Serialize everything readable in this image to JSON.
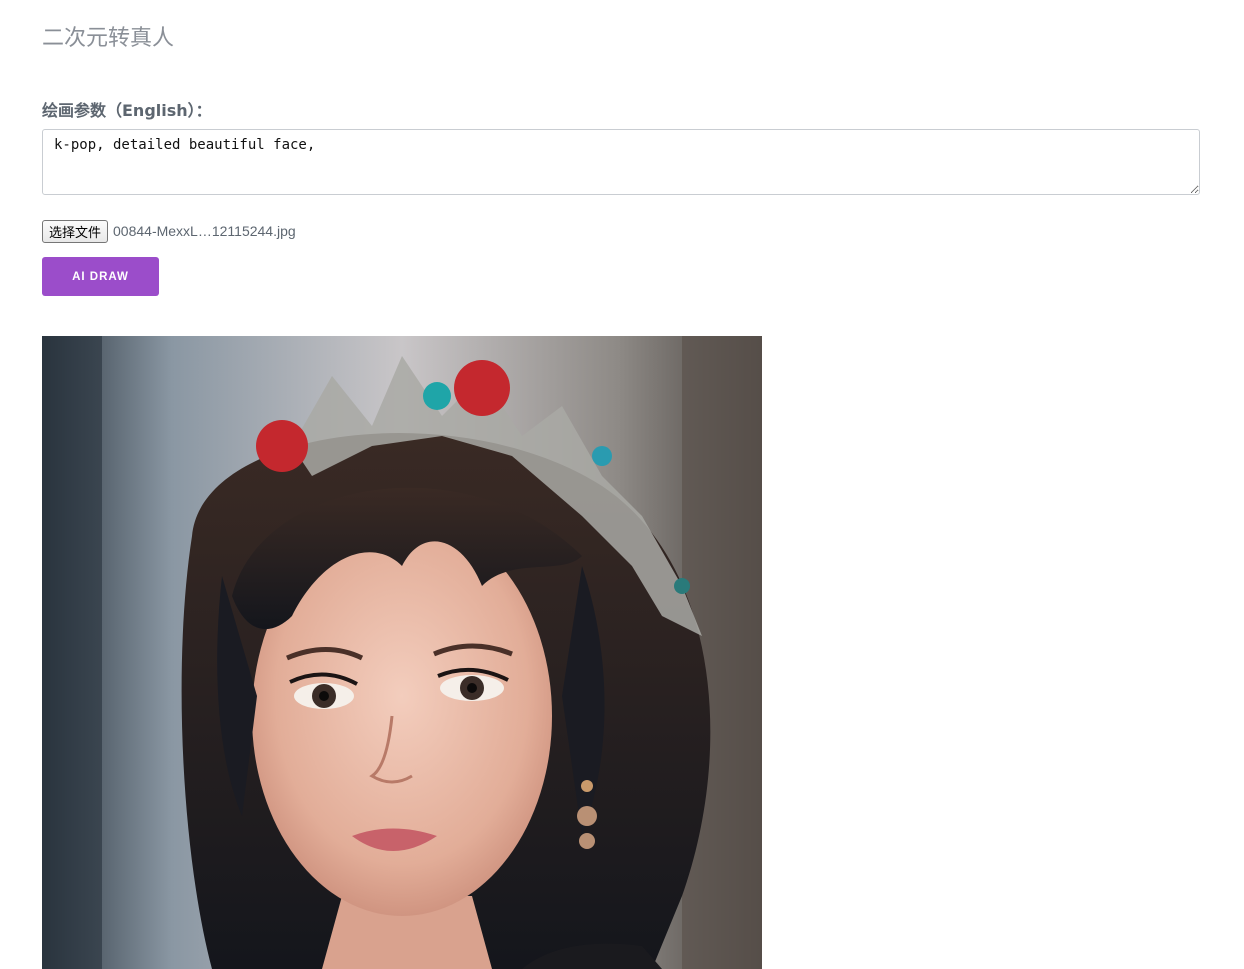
{
  "page": {
    "title": "二次元转真人"
  },
  "form": {
    "prompt_label": "绘画参数（English）：",
    "prompt_value": "k-pop, detailed beautiful face,",
    "file_button_label": "选择文件",
    "file_name": "00844-MexxL…12115244.jpg",
    "submit_label": "AI DRAW",
    "accent_color": "#9b4dca"
  },
  "result": {
    "image_alt": "generated portrait"
  }
}
